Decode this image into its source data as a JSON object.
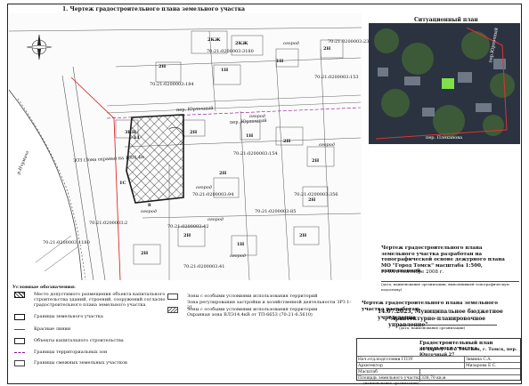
{
  "plan": {
    "heading": "1. Чертеж градостроительного плана земельного участка",
    "situation_heading": "Ситуационный план",
    "plot_labels": [
      "огород",
      "огород",
      "огород",
      "огород",
      "огород",
      "огород",
      "огород"
    ],
    "river_label": "р.Ичумиха",
    "cadastral_labels": [
      "70:21:0200003:231",
      "70:21:0200003:3180",
      "70:21:0200003:153",
      "70:21:0200003:154",
      "70:21:0200003:94",
      "70:21:0200003:356",
      "70:21:0200003:42",
      "70:21:0200003:85",
      "70:21:0200003:41",
      "70:21:0200003:2",
      "70:21:0200003:1180",
      "70:21:0200003:184"
    ],
    "street_labels": [
      "пер. Юрточный",
      "пер. Юрточный"
    ],
    "building_marks": [
      "2КЖ",
      "2КЖ",
      "2Н",
      "3КН",
      "2Н",
      "1Н",
      "2Н",
      "2Н",
      "2Н",
      "2Н",
      "2Н",
      "1Н",
      "2Н",
      "2Н",
      "2Н",
      "1Н",
      "1Н"
    ],
    "site_points": [
      "11",
      "1С",
      "8"
    ],
    "zone_label": "ЗОЗ (Зона охраны) на 1004.4м",
    "situation_street": "пер. Плеханова",
    "situation_street2": "пер.Юрточный"
  },
  "description": {
    "text": "Чертеж градостроительного плана земельного участка разработан на топографической основе дежурного плана МО \"Город Томск\" масштаба 1:500, выполненной",
    "done": "ГГТА в сентябре 2008 г.",
    "note": "(дата, наименование организации, выполнившей топографическую подоснову)",
    "prepared": "Чертеж градостроительного плана земельного участка разработан",
    "org_date": "14.07.2023, Муниципальное бюджетное учреждение",
    "org_name": "\"Архитектурно-планировочное управление\"",
    "org_note": "(дата, наименование организации)"
  },
  "legend": {
    "title": "Условные обозначения:",
    "items": [
      "Место допустимого размещения объекта капитального строительства зданий, строений, сооружений согласно градостроительного плана земельного участка",
      "Границы земельного участка",
      "Красные линии",
      "Объекты капитального строительства",
      "Границы территориальных зон",
      "Границы смежных земельных участков"
    ],
    "zones": [
      "Зоны с особыми условиями использования территорий",
      "Зона регулирования застройки и хозяйственной деятельности ЗРЗ 1-21",
      "Зоны с особыми условиями использования территории",
      "Охранная зона ВЛЭ14.4кВ от ТП-6653 (70:21-6.5610)"
    ]
  },
  "title_block": {
    "title": "Градостроительный план земельного участка",
    "address": "по адресу: обл. Томская, г. Томск, пер. Юрточный,27",
    "rows": [
      {
        "role": "Нач.отд.подготовки ГПЗУ",
        "name": "Зимина С.А."
      },
      {
        "role": "Архитектор",
        "name": "Мизарова Е.С."
      },
      {
        "role": "Масштаб",
        "name": ""
      },
      {
        "role": "Площадь земельного участка",
        "name": "338,70 кв.м"
      }
    ],
    "org": "(наименование организации)"
  },
  "colors": {
    "site_border": "#1a1a1a",
    "red_line": "#d11",
    "zone_line": "#8a0a8a",
    "map_bg": "#fbfbfb"
  }
}
